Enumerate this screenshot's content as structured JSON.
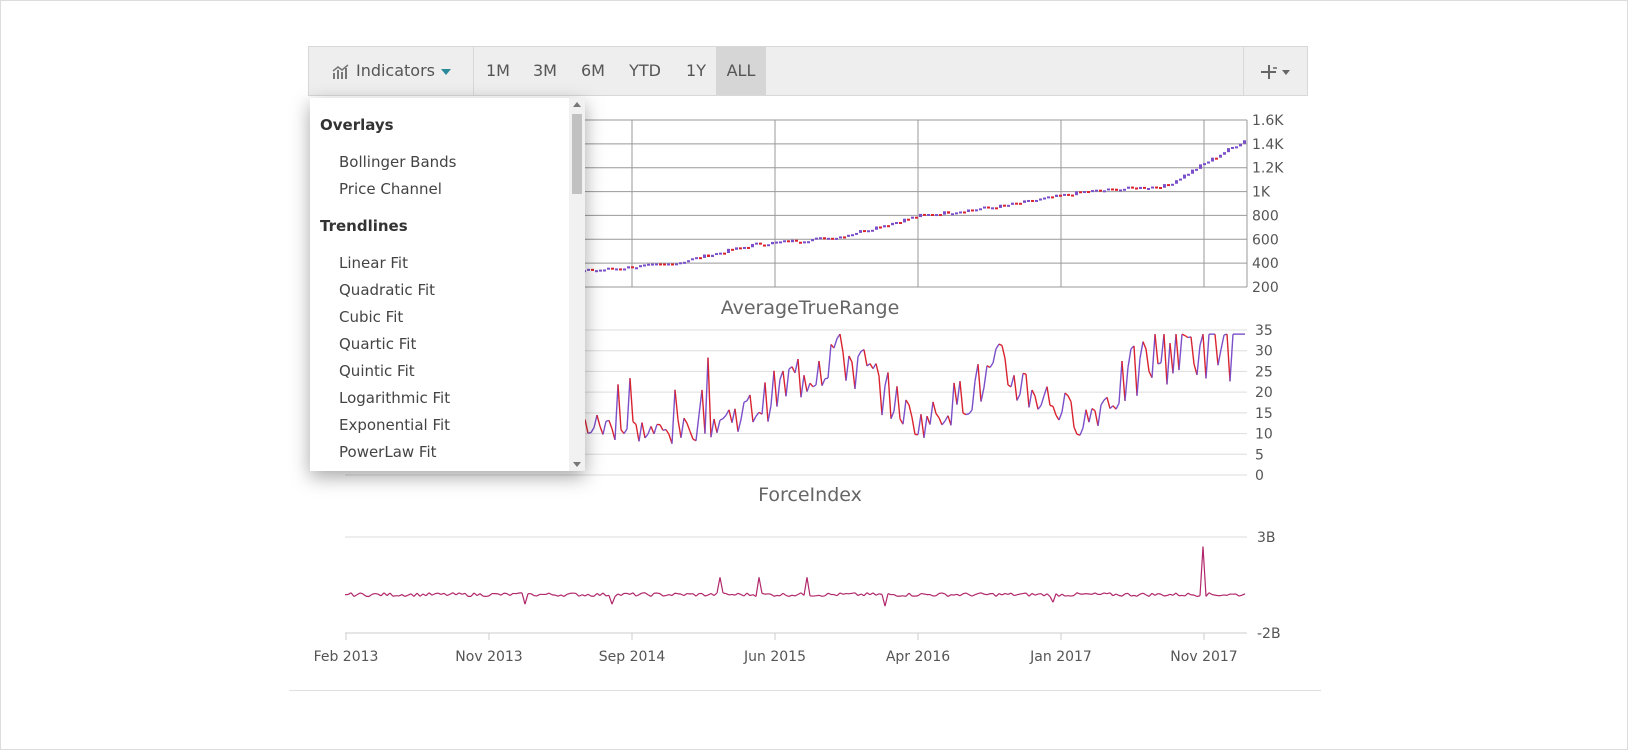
{
  "toolbar": {
    "indicators_label": "Indicators",
    "ranges": [
      "1M",
      "3M",
      "6M",
      "YTD",
      "1Y",
      "ALL"
    ],
    "active_range": "ALL",
    "crosshair_icon": "crosshair-icon"
  },
  "dropdown": {
    "overlays_header": "Overlays",
    "overlays": [
      "Bollinger Bands",
      "Price Channel"
    ],
    "trendlines_header": "Trendlines",
    "trendlines": [
      "Linear Fit",
      "Quadratic Fit",
      "Cubic Fit",
      "Quartic Fit",
      "Quintic Fit",
      "Logarithmic Fit",
      "Exponential Fit",
      "PowerLaw Fit"
    ]
  },
  "chart_data": [
    {
      "type": "candlestick",
      "title": "",
      "y_ticks": [
        "1.6K",
        "1.4K",
        "1.2K",
        "1K",
        "800",
        "600",
        "400",
        "200"
      ],
      "ylim": [
        200,
        1600
      ],
      "x_ticks": [
        "Feb 2013",
        "Nov 2013",
        "Sep 2014",
        "Jun 2015",
        "Apr 2016",
        "Jan 2017",
        "Nov 2017"
      ],
      "x": [
        "2013-02",
        "2013-08",
        "2014-02",
        "2014-08",
        "2015-02",
        "2015-08",
        "2016-02",
        "2016-08",
        "2017-02",
        "2017-08",
        "2017-11",
        "2018-01"
      ],
      "close": [
        270,
        290,
        310,
        340,
        400,
        560,
        620,
        800,
        880,
        1000,
        1050,
        1450
      ],
      "colors": {
        "up": "#7b4fc9",
        "down": "#d9232e"
      }
    },
    {
      "type": "line",
      "title": "AverageTrueRange",
      "y_ticks": [
        "35",
        "30",
        "25",
        "20",
        "15",
        "10",
        "5",
        "0"
      ],
      "ylim": [
        0,
        35
      ],
      "x": [
        "2013-02",
        "2013-08",
        "2014-02",
        "2014-08",
        "2015-02",
        "2015-08",
        "2016-02",
        "2016-08",
        "2017-02",
        "2017-08",
        "2017-11",
        "2018-01"
      ],
      "values": [
        6,
        8,
        8,
        12,
        10,
        16,
        31,
        12,
        25,
        13,
        31,
        32
      ],
      "colors": {
        "up": "#7b4fc9",
        "down": "#d9232e"
      }
    },
    {
      "type": "line",
      "title": "ForceIndex",
      "y_ticks": [
        "3B",
        "-2B"
      ],
      "ylim": [
        -2,
        3
      ],
      "x": [
        "2013-02",
        "2013-08",
        "2014-02",
        "2014-08",
        "2015-02",
        "2015-08",
        "2016-02",
        "2016-08",
        "2017-02",
        "2017-08",
        "2017-11",
        "2018-01"
      ],
      "values": [
        0,
        0,
        0,
        0.9,
        0,
        0.7,
        -0.3,
        0,
        0,
        0,
        2.5,
        0
      ],
      "colors": {
        "line": "#b0266a"
      }
    }
  ]
}
